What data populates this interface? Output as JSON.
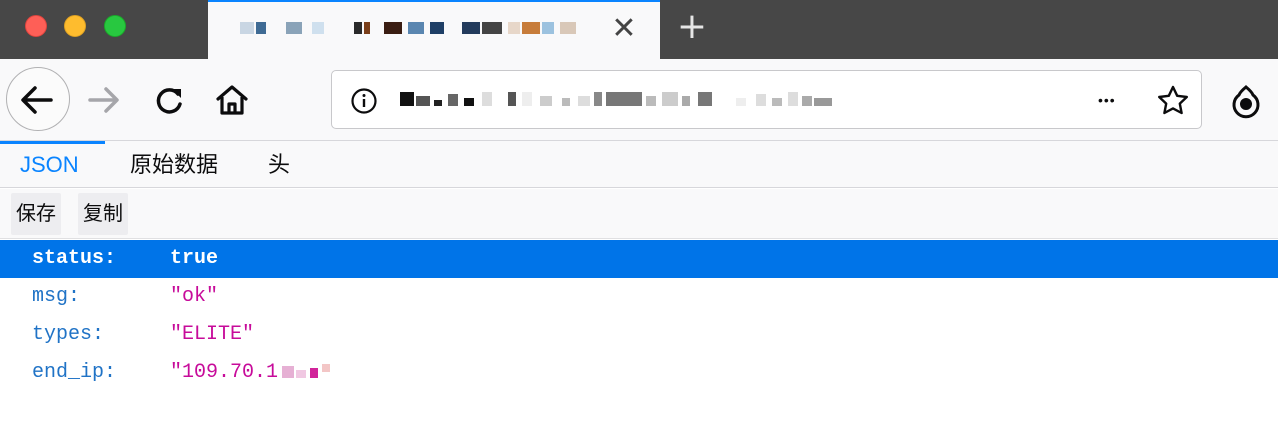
{
  "window": {
    "controls": [
      "close-button",
      "minimize-button",
      "maximize-button"
    ],
    "colors": {
      "close": "#fe5f57",
      "minimize": "#febc2e",
      "maximize": "#28c840"
    }
  },
  "browser_tab": {
    "close_glyph": "✕",
    "new_tab_glyph": "+"
  },
  "toolbar": {
    "icons": [
      "back-arrow-icon",
      "forward-arrow-icon",
      "reload-icon",
      "home-icon",
      "info-icon",
      "more-actions-icon",
      "bookmark-star-icon",
      "extension-icon"
    ],
    "more_glyph": "•••"
  },
  "viewer": {
    "tabs": [
      {
        "label": "JSON",
        "active": true
      },
      {
        "label": "原始数据",
        "active": false
      },
      {
        "label": "头",
        "active": false
      }
    ],
    "buttons": {
      "save": "保存",
      "copy": "复制"
    },
    "accent_color": "#0a84ff",
    "selected_row_color": "#0074e8"
  },
  "json_rows": [
    {
      "key": "status:",
      "value": "true",
      "selected": true
    },
    {
      "key": "msg:",
      "value": "\"ok\"",
      "selected": false
    },
    {
      "key": "types:",
      "value": "\"ELITE\"",
      "selected": false
    },
    {
      "key": "end_ip:",
      "value": "\"109.70.1",
      "selected": false
    }
  ]
}
